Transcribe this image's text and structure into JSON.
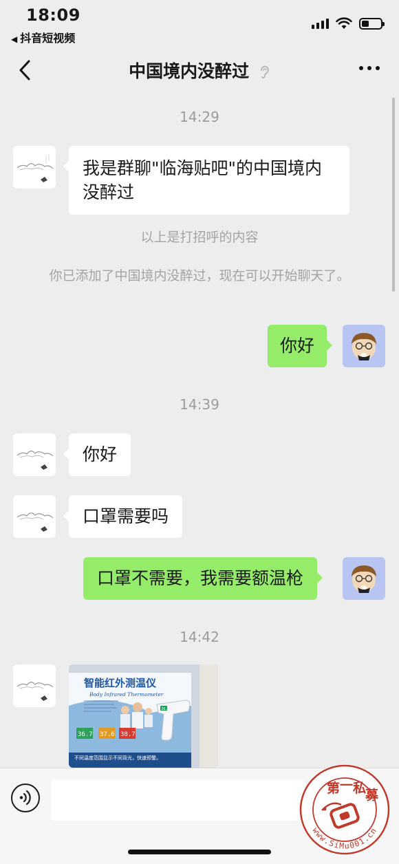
{
  "status_bar": {
    "time": "18:09",
    "back_app": "抖音短视频",
    "back_arrow": "◀"
  },
  "nav": {
    "title": "中国境内没醉过",
    "back_icon": "chevron-left",
    "ear_icon": "listen-ear",
    "more_icon": "ellipsis"
  },
  "messages": {
    "ts1": "14:29",
    "m1": "我是群聊\"临海贴吧\"的中国境内没醉过",
    "sys1": "以上是打招呼的内容",
    "sys2": "你已添加了中国境内没醉过，现在可以开始聊天了。",
    "m2": "你好",
    "ts2": "14:39",
    "m3": "你好",
    "m4": "口罩需要吗",
    "m5": "口罩不需要，我需要额温枪",
    "ts3": "14:42"
  },
  "image_message": {
    "title": "智能红外测温仪",
    "subtitle": "Body Infrared Thermometer",
    "readings": [
      "36.7",
      "37.6",
      "38.7"
    ],
    "gun_reading": "36.5",
    "footer": "不同温度范围显示不同背光，快速预警。"
  },
  "input_bar": {
    "voice_icon": "voice",
    "input_value": ""
  },
  "watermark": {
    "text": "第一私募",
    "url": "www.SiMu001.cn"
  },
  "colors": {
    "background": "#ededed",
    "my_bubble": "#95ec69",
    "their_bubble": "#ffffff",
    "stamp": "#c0392b"
  }
}
